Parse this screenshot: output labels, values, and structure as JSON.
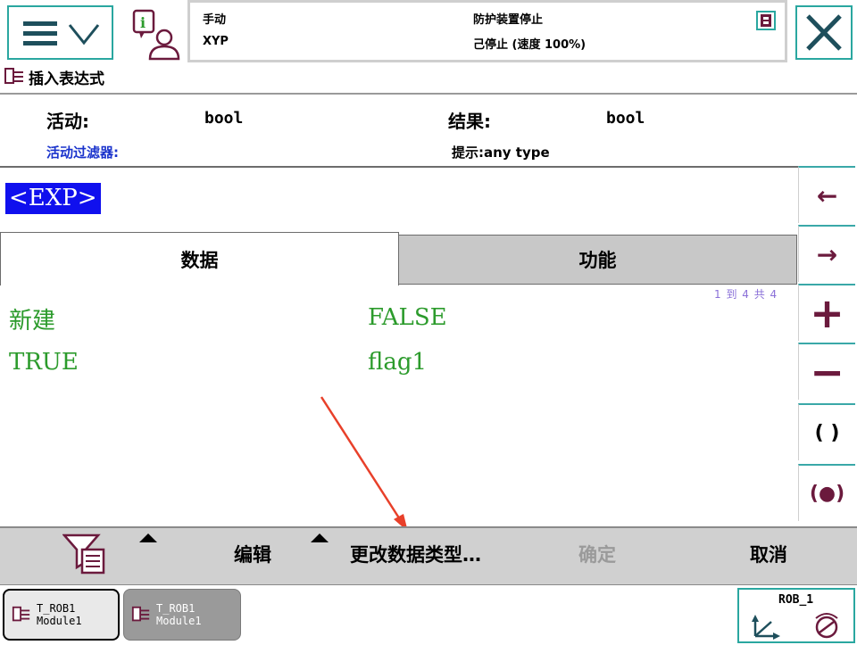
{
  "header": {
    "mode": "手动",
    "system": "XYP",
    "safety_status": "防护装置停止",
    "run_status": "己停止 (速度 100%)",
    "title": "插入表达式"
  },
  "info": {
    "active_label": "活动:",
    "active_value": "bool",
    "result_label": "结果:",
    "result_value": "bool",
    "filter_label": "活动过滤器:",
    "hint": "提示:any type"
  },
  "expression": {
    "token": "<EXP>"
  },
  "tabs": [
    {
      "label": "数据",
      "active": true
    },
    {
      "label": "功能",
      "active": false
    }
  ],
  "list": {
    "pager": "1 到 4 共 4",
    "items": [
      "新建",
      "FALSE",
      "TRUE",
      "flag1"
    ]
  },
  "side_buttons": [
    "←",
    "→",
    "+",
    "−",
    "( )",
    "(●)"
  ],
  "command_bar": {
    "edit": "编辑",
    "change_type": "更改数据类型…",
    "confirm": "确定",
    "cancel": "取消"
  },
  "taskbar": {
    "tasks": [
      {
        "task": "T_ROB1",
        "module": "Module1",
        "active": true
      },
      {
        "task": "T_ROB1",
        "module": "Module1",
        "active": false
      }
    ],
    "robot": "ROB_1"
  },
  "colors": {
    "accent_teal": "#2aa7a0",
    "list_green": "#2c9b2c",
    "exp_blue": "#1010ee",
    "side_glyph": "#6b1a3d",
    "annotation_red": "#e8402a"
  }
}
